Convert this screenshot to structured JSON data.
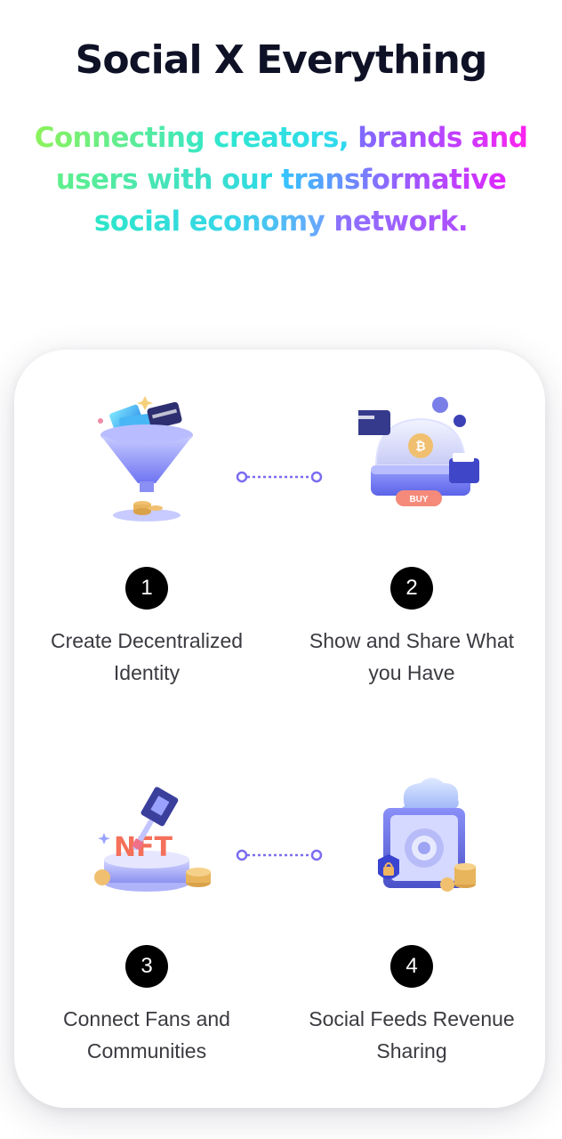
{
  "header": {
    "title": "Social X Everything",
    "subtitle_parts": {
      "p1": "Connecting creators,",
      "p2": "brands and",
      "p3": "users with our",
      "p4": "transformative",
      "p5": "social economy",
      "p6": "network."
    }
  },
  "steps": [
    {
      "number": "1",
      "label_line1": "Create Decentralized",
      "label_line2": "Identity",
      "icon": "funnel-money-icon"
    },
    {
      "number": "2",
      "label_line1": "Show and Share What",
      "label_line2": "you Have",
      "icon": "crypto-wallet-buy-icon"
    },
    {
      "number": "3",
      "label_line1": "Connect Fans and",
      "label_line2": "Communities",
      "icon": "nft-gavel-icon"
    },
    {
      "number": "4",
      "label_line1": "Social Feeds Revenue",
      "label_line2": "Sharing",
      "icon": "cloud-safe-lock-icon"
    }
  ],
  "colors": {
    "title": "#0f1226",
    "accent_purple": "#7b6cf0",
    "number_badge": "#000000",
    "label": "#3a3a40"
  }
}
